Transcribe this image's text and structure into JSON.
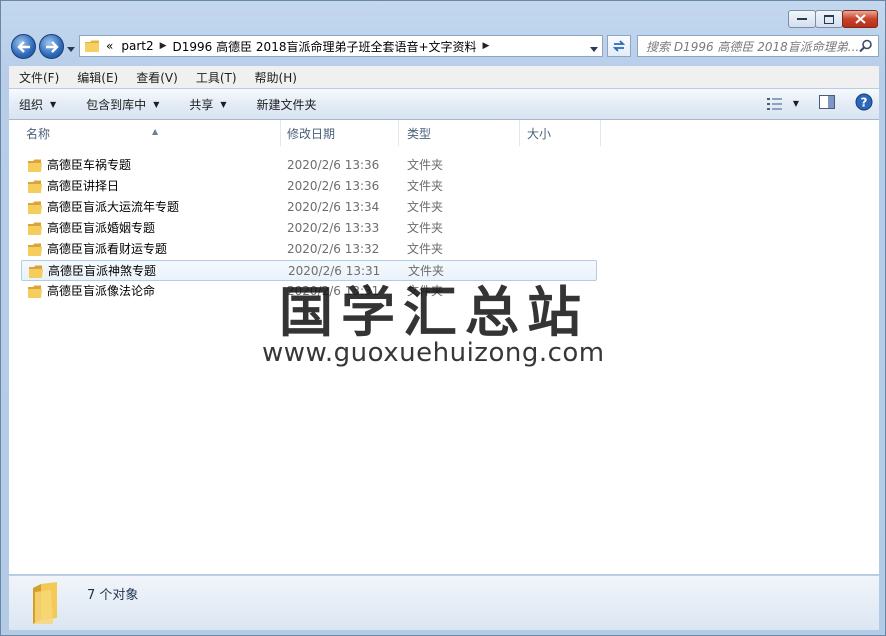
{
  "addressbar": {
    "overflow": "«",
    "crumbs": [
      "part2",
      "D1996 高德臣 2018盲派命理弟子班全套语音+文字资料"
    ],
    "search_placeholder": "搜索 D1996 高德臣 2018盲派命理弟..."
  },
  "menu": [
    "文件(F)",
    "编辑(E)",
    "查看(V)",
    "工具(T)",
    "帮助(H)"
  ],
  "toolbar": {
    "organize": "组织",
    "include_library": "包含到库中",
    "share": "共享",
    "new_folder": "新建文件夹"
  },
  "columns": {
    "name": "名称",
    "date": "修改日期",
    "type": "类型",
    "size": "大小"
  },
  "files": [
    {
      "name": "高德臣车祸专题",
      "date": "2020/2/6 13:36",
      "type": "文件夹"
    },
    {
      "name": "高德臣讲择日",
      "date": "2020/2/6 13:36",
      "type": "文件夹"
    },
    {
      "name": "高德臣盲派大运流年专题",
      "date": "2020/2/6 13:34",
      "type": "文件夹"
    },
    {
      "name": "高德臣盲派婚姻专题",
      "date": "2020/2/6 13:33",
      "type": "文件夹"
    },
    {
      "name": "高德臣盲派看财运专题",
      "date": "2020/2/6 13:32",
      "type": "文件夹"
    },
    {
      "name": "高德臣盲派神煞专题",
      "date": "2020/2/6 13:31",
      "type": "文件夹"
    },
    {
      "name": "高德臣盲派像法论命",
      "date": "2020/2/6 13:31",
      "type": "文件夹"
    }
  ],
  "selected_index": 5,
  "watermark": {
    "title": "国学汇总站",
    "url": "www.guoxuehuizong.com"
  },
  "status": {
    "count": "7 个对象"
  },
  "colors": {
    "accent": "#2c68b9",
    "folder": "#f0c24a",
    "close": "#c8432a"
  }
}
